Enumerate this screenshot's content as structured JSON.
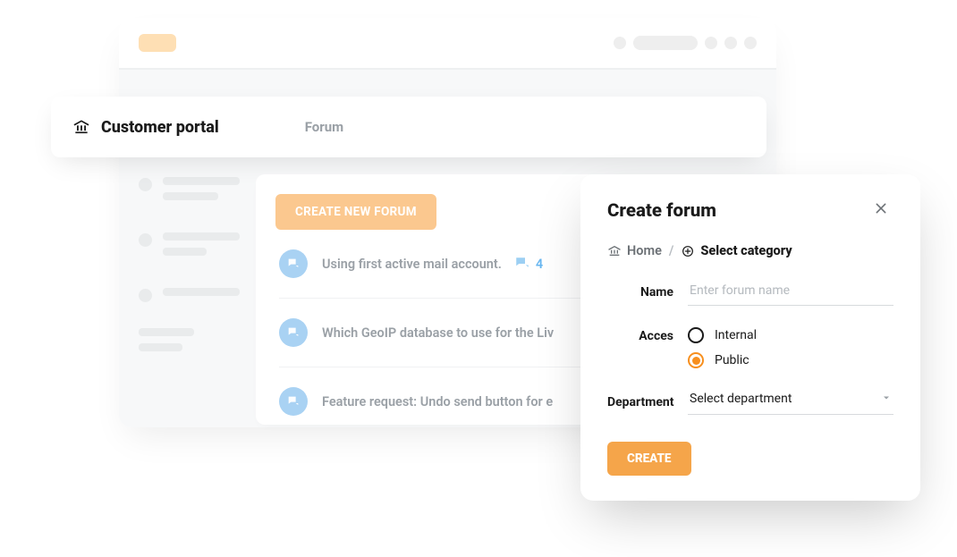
{
  "header": {
    "title": "Customer portal",
    "tab": "Forum"
  },
  "list": {
    "create_button": "CREATE NEW FORUM",
    "threads": [
      {
        "title": "Using first active mail account.",
        "count": "4"
      },
      {
        "title": "Which GeoIP database to use for the Liv"
      },
      {
        "title": "Feature request: Undo send button for e"
      }
    ]
  },
  "modal": {
    "title": "Create forum",
    "breadcrumb_home": "Home",
    "breadcrumb_select": "Select category",
    "fields": {
      "name_label": "Name",
      "name_placeholder": "Enter forum name",
      "access_label": "Acces",
      "access_options": {
        "internal": "Internal",
        "public": "Public"
      },
      "access_selected": "public",
      "dept_label": "Department",
      "dept_value": "Select department"
    },
    "create_button": "CREATE"
  },
  "colors": {
    "accent": "#f78f1e"
  }
}
